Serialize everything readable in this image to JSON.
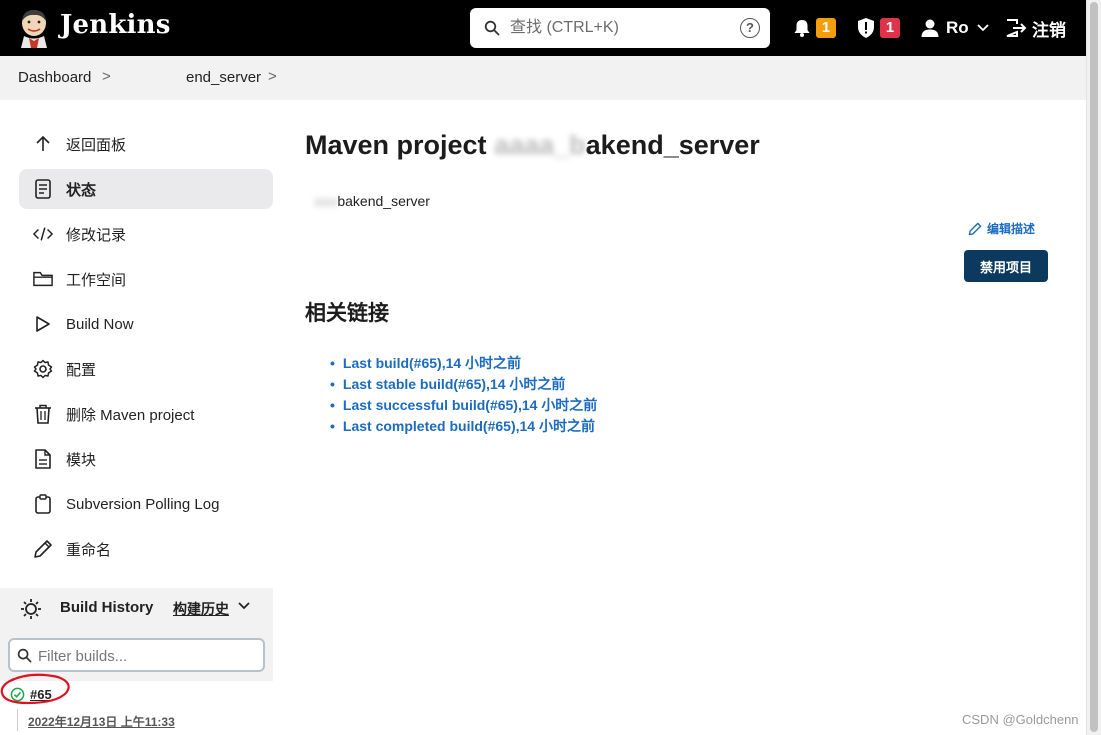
{
  "header": {
    "brand": "Jenkins",
    "search_placeholder": "查找 (CTRL+K)",
    "help_label": "?",
    "notifications_count": "1",
    "security_count": "1",
    "user_name": "Ro",
    "logout_label": "注销"
  },
  "breadcrumb": {
    "items": [
      "Dashboard",
      "end_server"
    ],
    "separator": ">"
  },
  "sidebar": {
    "items": [
      {
        "label": "返回面板",
        "icon": "arrow-up-icon"
      },
      {
        "label": "状态",
        "icon": "document-icon",
        "active": true
      },
      {
        "label": "修改记录",
        "icon": "code-icon"
      },
      {
        "label": "工作空间",
        "icon": "folder-icon"
      },
      {
        "label": "Build Now",
        "icon": "play-icon"
      },
      {
        "label": "配置",
        "icon": "gear-icon"
      },
      {
        "label": "删除 Maven project",
        "icon": "trash-icon"
      },
      {
        "label": "模块",
        "icon": "file-icon"
      },
      {
        "label": "Subversion Polling Log",
        "icon": "clipboard-icon"
      },
      {
        "label": "重命名",
        "icon": "pencil-icon"
      }
    ]
  },
  "build_history": {
    "title": "Build History",
    "trend_label": "构建历史",
    "filter_placeholder": "Filter builds...",
    "builds": [
      {
        "number": "#65",
        "date": "2022年12月13日 上午11:33",
        "status": "success"
      }
    ]
  },
  "main": {
    "title_prefix": "Maven project",
    "title_blurred": "aaaa_b",
    "title_suffix": "akend_server",
    "description_blurred": "aaa",
    "description": "bakend_server",
    "edit_description": "编辑描述",
    "disable_button": "禁用项目",
    "related_heading": "相关链接",
    "links": [
      "Last build(#65),14 小时之前",
      "Last stable build(#65),14 小时之前",
      "Last successful build(#65),14 小时之前",
      "Last completed build(#65),14 小时之前"
    ]
  },
  "watermark": "CSDN @Goldchenn",
  "colors": {
    "header_bg": "#000000",
    "link": "#1b6bbf",
    "primary_button": "#0c3a5e",
    "notification_badge": "#f59e0b",
    "security_badge": "#e0334a",
    "success": "#1ea64b"
  }
}
